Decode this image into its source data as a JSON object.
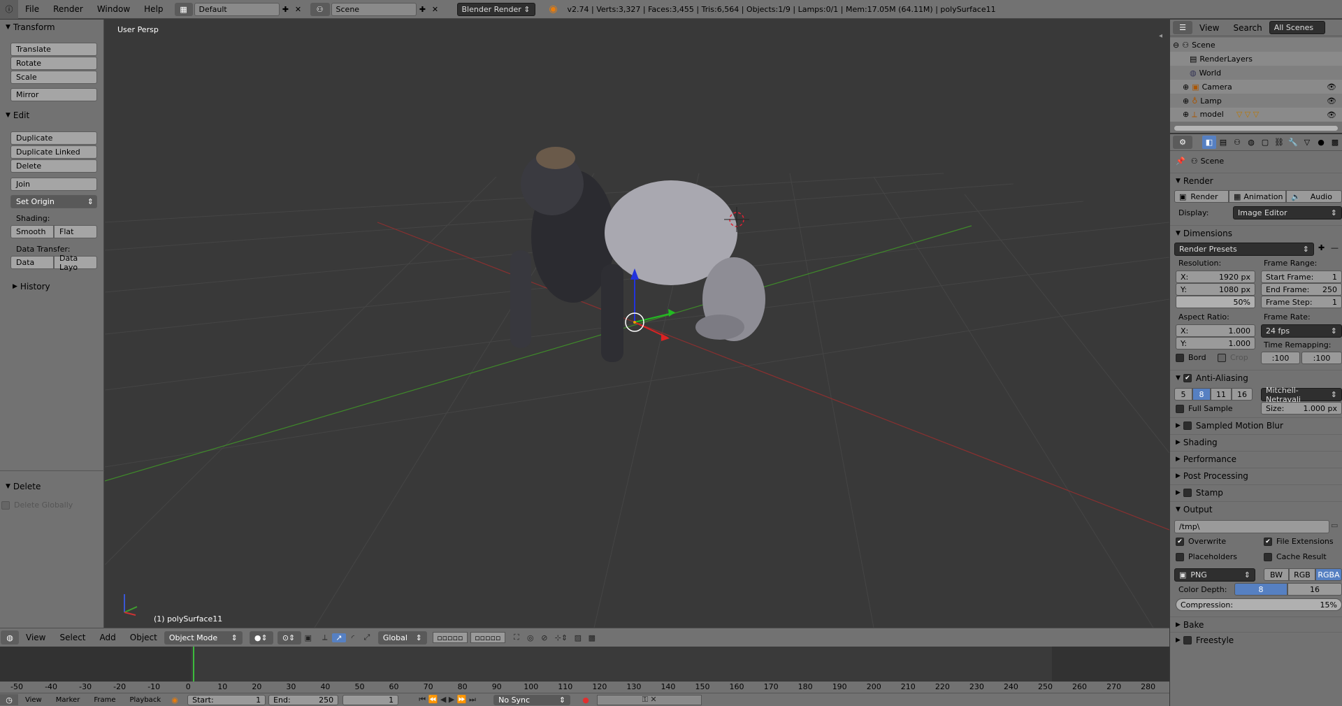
{
  "topbar": {
    "menus": [
      "File",
      "Render",
      "Window",
      "Help"
    ],
    "layout": "Default",
    "scene": "Scene",
    "engine": "Blender Render",
    "stats": "v2.74 | Verts:3,327 | Faces:3,455 | Tris:6,564 | Objects:1/9 | Lamps:0/1 | Mem:17.05M (64.11M) | polySurface11"
  },
  "toolshelf": {
    "transform_title": "Transform",
    "translate": "Translate",
    "rotate": "Rotate",
    "scale": "Scale",
    "mirror": "Mirror",
    "edit_title": "Edit",
    "duplicate": "Duplicate",
    "duplicate_linked": "Duplicate Linked",
    "delete": "Delete",
    "join": "Join",
    "set_origin": "Set Origin",
    "shading_label": "Shading:",
    "smooth": "Smooth",
    "flat": "Flat",
    "data_transfer_label": "Data Transfer:",
    "data": "Data",
    "data_layout": "Data Layo",
    "history_title": "History",
    "operator_title": "Delete",
    "delete_globally": "Delete Globally"
  },
  "viewport": {
    "view_label": "User Persp",
    "object_label": "(1) polySurface11"
  },
  "view_header": {
    "menus": [
      "View",
      "Select",
      "Add",
      "Object"
    ],
    "mode": "Object Mode",
    "orientation": "Global"
  },
  "timeline": {
    "ticks": [
      "-50",
      "-40",
      "-30",
      "-20",
      "-10",
      "0",
      "10",
      "20",
      "30",
      "40",
      "50",
      "60",
      "70",
      "80",
      "90",
      "100",
      "110",
      "120",
      "130",
      "140",
      "150",
      "160",
      "170",
      "180",
      "190",
      "200",
      "210",
      "220",
      "230",
      "240",
      "250",
      "260",
      "270",
      "280"
    ],
    "menus": [
      "View",
      "Marker",
      "Frame",
      "Playback"
    ],
    "start_label": "Start:",
    "start_value": "1",
    "end_label": "End:",
    "end_value": "250",
    "current": "1",
    "sync": "No Sync"
  },
  "outliner": {
    "view": "View",
    "search": "Search",
    "filter": "All Scenes",
    "items": [
      {
        "label": "Scene",
        "indent": 0
      },
      {
        "label": "RenderLayers",
        "indent": 1
      },
      {
        "label": "World",
        "indent": 1
      },
      {
        "label": "Camera",
        "indent": 1
      },
      {
        "label": "Lamp",
        "indent": 1
      },
      {
        "label": "model",
        "indent": 1
      }
    ]
  },
  "properties": {
    "context": "Scene",
    "render_title": "Render",
    "render_btn": "Render",
    "animation_btn": "Animation",
    "audio_btn": "Audio",
    "display_label": "Display:",
    "display_value": "Image Editor",
    "dimensions_title": "Dimensions",
    "render_presets": "Render Presets",
    "resolution_label": "Resolution:",
    "res_x": "1920 px",
    "res_y": "1080 px",
    "res_pct": "50%",
    "frame_range_label": "Frame Range:",
    "start_frame": "Start Frame:",
    "start_frame_v": "1",
    "end_frame": "End Frame:",
    "end_frame_v": "250",
    "frame_step": "Frame Step:",
    "frame_step_v": "1",
    "aspect_label": "Aspect Ratio:",
    "asp_x": "1.000",
    "asp_y": "1.000",
    "frame_rate_label": "Frame Rate:",
    "frame_rate": "24 fps",
    "time_remap": "Time Remapping:",
    "remap_old": ":100",
    "remap_new": ":100",
    "bord": "Bord",
    "crop": "Crop",
    "aa_title": "Anti-Aliasing",
    "aa_samples": [
      "5",
      "8",
      "11",
      "16"
    ],
    "aa_filter": "Mitchell-Netravali",
    "full_sample": "Full Sample",
    "size_label": "Size:",
    "size_value": "1.000 px",
    "motion_blur": "Sampled Motion Blur",
    "shading": "Shading",
    "performance": "Performance",
    "post_processing": "Post Processing",
    "stamp": "Stamp",
    "output_title": "Output",
    "output_path": "/tmp\\",
    "overwrite": "Overwrite",
    "file_ext": "File Extensions",
    "placeholders": "Placeholders",
    "cache_result": "Cache Result",
    "format": "PNG",
    "bw": "BW",
    "rgb": "RGB",
    "rgba": "RGBA",
    "color_depth_label": "Color Depth:",
    "depth_8": "8",
    "depth_16": "16",
    "compression_label": "Compression:",
    "compression_value": "15%",
    "bake": "Bake",
    "freestyle": "Freestyle"
  }
}
